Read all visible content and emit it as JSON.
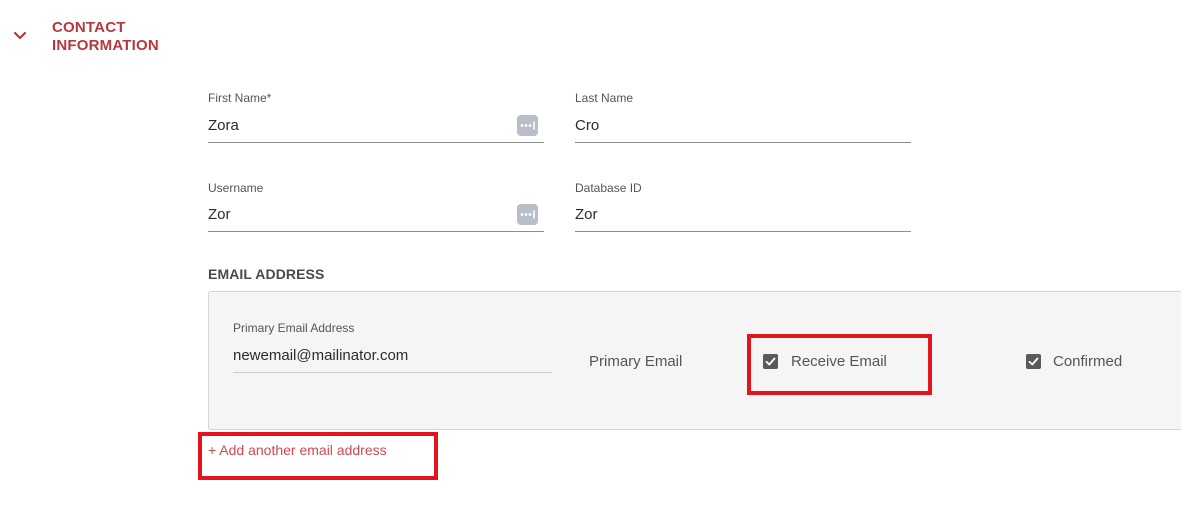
{
  "section": {
    "title": "CONTACT\nINFORMATION",
    "toggle_icon": "chevron-down-icon",
    "accent_color": "#b8373d"
  },
  "fields": {
    "first_name": {
      "label": "First Name*",
      "value": "Zora",
      "action_icon": "more-dots-icon"
    },
    "last_name": {
      "label": "Last Name",
      "value": "Cro"
    },
    "username": {
      "label": "Username",
      "value": "Zor",
      "action_icon": "more-dots-icon"
    },
    "database_id": {
      "label": "Database ID",
      "value": "Zor"
    }
  },
  "email_section": {
    "heading": "EMAIL ADDRESS",
    "entry": {
      "label": "Primary Email Address",
      "value": "newemail@mailinator.com",
      "primary_text": "Primary Email",
      "receive_email": {
        "label": "Receive Email",
        "checked": true
      },
      "confirmed": {
        "label": "Confirmed",
        "checked": true
      }
    },
    "add_link": "+ Add another email address"
  },
  "annotations": {
    "highlight_color": "#e3141d"
  }
}
